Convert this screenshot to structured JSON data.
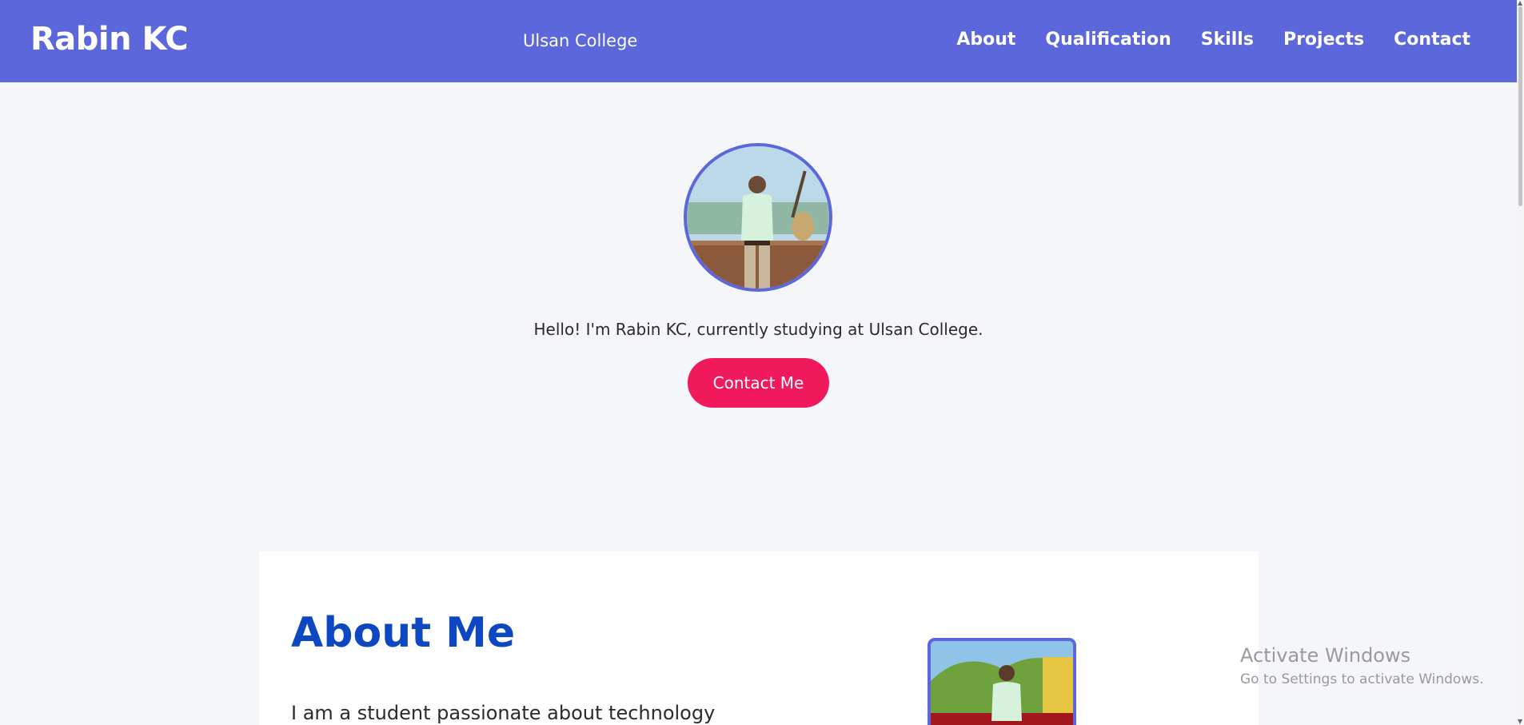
{
  "header": {
    "brand": "Rabin KC",
    "college": "Ulsan College",
    "nav": [
      "About",
      "Qualification",
      "Skills",
      "Projects",
      "Contact"
    ]
  },
  "hero": {
    "intro": "Hello! I'm Rabin KC, currently studying at Ulsan College.",
    "contact_label": "Contact Me"
  },
  "about": {
    "title": "About Me",
    "text": "I am a student passionate about technology"
  },
  "watermark": {
    "title": "Activate Windows",
    "subtitle": "Go to Settings to activate Windows."
  },
  "colors": {
    "nav_bg": "#5b67db",
    "accent_button": "#f0195c",
    "heading_blue": "#0d47c1",
    "page_bg": "#f5f6fa"
  }
}
